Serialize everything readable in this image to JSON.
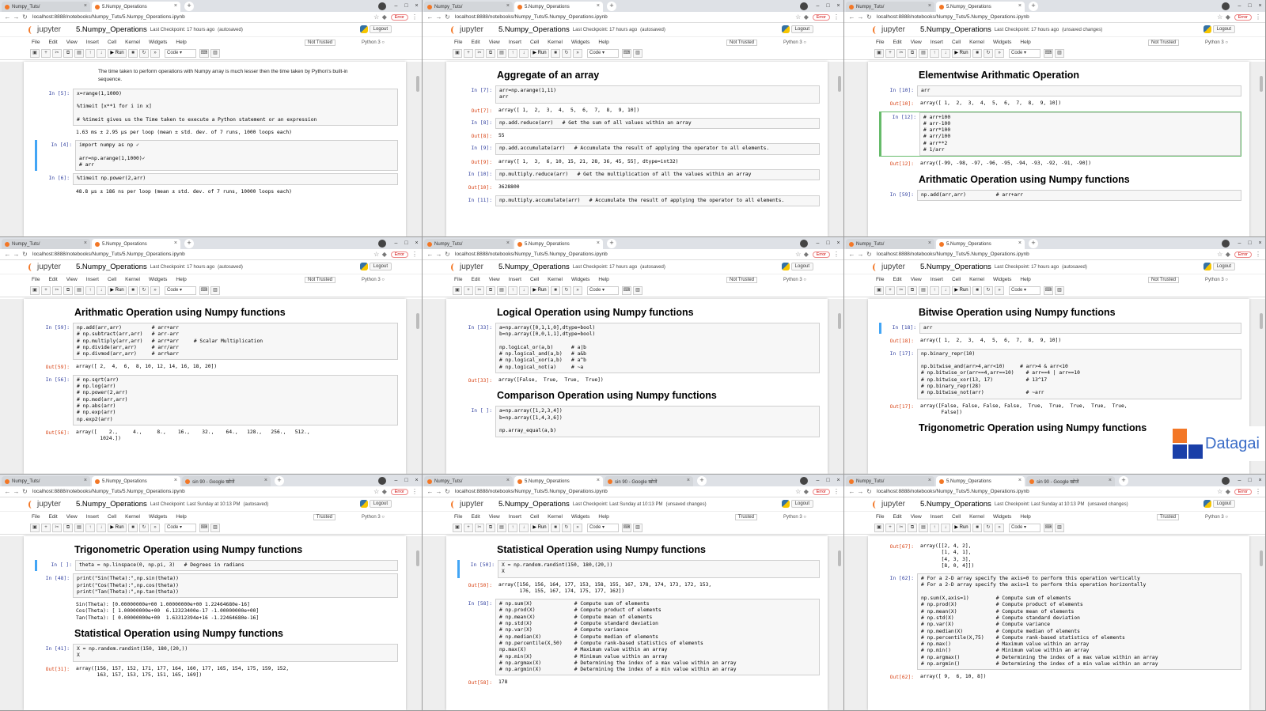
{
  "common": {
    "jupyter": "jupyter",
    "logout": "Logout",
    "not_trusted": "Not Trusted",
    "trusted": "Trusted",
    "kernel": "Python 3",
    "cell_type": "Code",
    "run": "Run",
    "menu": [
      "File",
      "Edit",
      "View",
      "Insert",
      "Cell",
      "Kernel",
      "Widgets",
      "Help"
    ],
    "tab_tuts": "Numpy_Tuts/",
    "tab_ops": "5.Numpy_Operations",
    "tab_google": "sin 90 - Google खोजें",
    "error": "Error"
  },
  "windows": [
    {
      "tabs": [
        "Numpy_Tuts/",
        "5.Numpy_Operations"
      ],
      "url": "localhost:8888/notebooks/Numpy_Tuts/5.Numpy_Operations.ipynb",
      "nb": "5.Numpy_Operations",
      "ckpt": "Last Checkpoint: 17 hours ago",
      "saved": "(autosaved)",
      "cells": [
        {
          "kind": "md",
          "text": "The time taken to perform operations with Numpy array is much lesser then the time taken by Python's built-in sequence."
        },
        {
          "kind": "in",
          "prompt": "In [5]:",
          "code": "x=range(1,1000)\n\n%timeit [x**1 for i in x]\n\n# %timeit gives us the Time taken to execute a Python statement or an expression"
        },
        {
          "kind": "out",
          "prompt": "",
          "text": "1.63 ms ± 2.95 µs per loop (mean ± std. dev. of 7 runs, 1000 loops each)"
        },
        {
          "kind": "in",
          "sel": true,
          "prompt": "In [4]:",
          "code": "import numpy as np ✓\n\narr=np.arange(1,1000)✓\n# arr"
        },
        {
          "kind": "in",
          "prompt": "In [6]:",
          "code": "%timeit np.power(2,arr)"
        },
        {
          "kind": "out",
          "prompt": "",
          "text": "48.8 µs ± 186 ns per loop (mean ± std. dev. of 7 runs, 10000 loops each)"
        }
      ]
    },
    {
      "tabs": [
        "Numpy_Tuts/",
        "5.Numpy_Operations"
      ],
      "url": "localhost:8888/notebooks/Numpy_Tuts/5.Numpy_Operations.ipynb",
      "nb": "5.Numpy_Operations",
      "ckpt": "Last Checkpoint: 17 hours ago",
      "saved": "(autosaved)",
      "cells": [
        {
          "kind": "h",
          "text": "Aggregate of an array"
        },
        {
          "kind": "in",
          "prompt": "In [7]:",
          "code": "arr=np.arange(1,11)\narr"
        },
        {
          "kind": "out",
          "prompt": "Out[7]:",
          "text": "array([ 1,  2,  3,  4,  5,  6,  7,  8,  9, 10])"
        },
        {
          "kind": "in",
          "prompt": "In [8]:",
          "code": "np.add.reduce(arr)   # Get the sum of all values within an array"
        },
        {
          "kind": "out",
          "prompt": "Out[8]:",
          "text": "55"
        },
        {
          "kind": "in",
          "prompt": "In [9]:",
          "code": "np.add.accumulate(arr)   # Accumulate the result of applying the operator to all elements."
        },
        {
          "kind": "out",
          "prompt": "Out[9]:",
          "text": "array([ 1,  3,  6, 10, 15, 21, 28, 36, 45, 55], dtype=int32)"
        },
        {
          "kind": "in",
          "prompt": "In [10]:",
          "code": "np.multiply.reduce(arr)   # Get the multiplication of all the values within an array"
        },
        {
          "kind": "out",
          "prompt": "Out[10]:",
          "text": "3628800"
        },
        {
          "kind": "in",
          "prompt": "In [11]:",
          "code": "np.multiply.accumulate(arr)   # Accumulate the result of applying the operator to all elements."
        }
      ]
    },
    {
      "tabs": [
        "Numpy_Tuts/",
        "5.Numpy_Operations"
      ],
      "url": "localhost:8888/notebooks/Numpy_Tuts/5.Numpy_Operations.ipynb",
      "nb": "5.Numpy_Operations",
      "ckpt": "Last Checkpoint: 17 hours ago",
      "saved": "(unsaved changes)",
      "cells": [
        {
          "kind": "h",
          "text": "Elementwise Arithmatic Operation"
        },
        {
          "kind": "in",
          "prompt": "In [10]:",
          "code": "arr"
        },
        {
          "kind": "out",
          "prompt": "Out[10]:",
          "text": "array([ 1,  2,  3,  4,  5,  6,  7,  8,  9, 10])"
        },
        {
          "kind": "in",
          "edit": true,
          "prompt": "In [12]:",
          "code": "# arr+100\n# arr-100\n# arr*100\n# arr/100\n# arr**2\n# 1/arr"
        },
        {
          "kind": "out",
          "prompt": "Out[12]:",
          "text": "array([-99, -98, -97, -96, -95, -94, -93, -92, -91, -90])"
        },
        {
          "kind": "h",
          "text": "Arithmatic Operation using Numpy functions"
        },
        {
          "kind": "in",
          "prompt": "In [59]:",
          "code": "np.add(arr,arr)          # arr+arr"
        }
      ]
    },
    {
      "tabs": [
        "Numpy_Tuts/",
        "5.Numpy_Operations"
      ],
      "url": "localhost:8888/notebooks/Numpy_Tuts/5.Numpy_Operations.ipynb",
      "nb": "5.Numpy_Operations",
      "ckpt": "Last Checkpoint: 17 hours ago",
      "saved": "(autosaved)",
      "cells": [
        {
          "kind": "h",
          "text": "Arithmatic Operation using Numpy functions"
        },
        {
          "kind": "in",
          "prompt": "In [59]:",
          "code": "np.add(arr,arr)          # arr+arr\n# np.subtract(arr,arr)   # arr-arr\n# np.multiply(arr,arr)   # arr*arr     # Scalar Multiplication\n# np.divide(arr,arr)     # arr/arr\n# np.divmod(arr,arr)     # arr%arr"
        },
        {
          "kind": "out",
          "prompt": "Out[59]:",
          "text": "array([ 2,  4,  6,  8, 10, 12, 14, 16, 18, 20])"
        },
        {
          "kind": "in",
          "prompt": "In [56]:",
          "code": "# np.sqrt(arr)\n# np.log(arr)\n# np.power(2,arr)\n# np.mod(arr,arr)\n# np.abs(arr)\n# np.exp(arr)\nnp.exp2(arr)"
        },
        {
          "kind": "out",
          "prompt": "Out[56]:",
          "text": "array([    2.,     4.,     8.,    16.,    32.,    64.,   128.,   256.,   512.,\n        1024.])"
        }
      ]
    },
    {
      "tabs": [
        "Numpy_Tuts/",
        "5.Numpy_Operations"
      ],
      "url": "localhost:8888/notebooks/Numpy_Tuts/5.Numpy_Operations.ipynb",
      "nb": "5.Numpy_Operations",
      "ckpt": "Last Checkpoint: 17 hours ago",
      "saved": "(autosaved)",
      "cells": [
        {
          "kind": "h",
          "text": "Logical Operation using Numpy functions"
        },
        {
          "kind": "in",
          "prompt": "In [33]:",
          "code": "a=np.array([0,1,1,0],dtype=bool)\nb=np.array([0,0,1,1],dtype=bool)\n\nnp.logical_or(a,b)      # a|b\n# np.logical_and(a,b)   # a&b\n# np.logical_xor(a,b)   # a^b\n# np.logical_not(a)     # ~a"
        },
        {
          "kind": "out",
          "prompt": "Out[33]:",
          "text": "array([False,  True,  True,  True])"
        },
        {
          "kind": "h",
          "text": "Comparison Operation using Numpy functions"
        },
        {
          "kind": "in",
          "prompt": "In [ ]:",
          "code": "a=np.array([1,2,3,4])\nb=np.array([1,4,3,6])\n\nnp.array_equal(a,b)"
        }
      ]
    },
    {
      "tabs": [
        "Numpy_Tuts/",
        "5.Numpy_Operations"
      ],
      "url": "localhost:8888/notebooks/Numpy_Tuts/5.Numpy_Operations.ipynb",
      "nb": "5.Numpy_Operations",
      "ckpt": "Last Checkpoint: 17 hours ago",
      "saved": "(autosaved)",
      "cells": [
        {
          "kind": "h",
          "text": "Bitwise Operation using Numpy functions"
        },
        {
          "kind": "in",
          "sel": true,
          "prompt": "In [18]:",
          "code": "arr"
        },
        {
          "kind": "out",
          "prompt": "Out[18]:",
          "text": "array([ 1,  2,  3,  4,  5,  6,  7,  8,  9, 10])"
        },
        {
          "kind": "in",
          "prompt": "In [17]:",
          "code": "np.binary_repr(10)\n\nnp.bitwise_and(arr>4,arr<10)     # arr>4 & arr<10\n# np.bitwise_or(arr==4,arr==10)    # arr==4 | arr==10\n# np.bitwise_xor(13, 17)           # 13^17\n# np.binary_repr(28)\n# np.bitwise_not(arr)              # ~arr"
        },
        {
          "kind": "out",
          "prompt": "Out[17]:",
          "text": "array([False, False, False, False,  True,  True,  True,  True,  True,\n       False])"
        },
        {
          "kind": "h",
          "text": "Trigonometric Operation using Numpy functions"
        }
      ],
      "logo": "Datagai"
    },
    {
      "tabs": [
        "Numpy_Tuts/",
        "5.Numpy_Operations",
        "sin 90 - Google खोजें"
      ],
      "url": "localhost:8888/notebooks/Numpy_Tuts/5.Numpy_Operations.ipynb",
      "nb": "5.Numpy_Operations",
      "ckpt": "Last Checkpoint: Last Sunday at 10:13 PM",
      "saved": "(autosaved)",
      "cells": [
        {
          "kind": "h",
          "text": "Trigonometric Operation using Numpy functions"
        },
        {
          "kind": "in",
          "sel": true,
          "prompt": "In [ ]:",
          "code": "theta = np.linspace(0, np.pi, 3)   # Degrees in radians"
        },
        {
          "kind": "in",
          "prompt": "In [48]:",
          "code": "print(\"Sin(Theta):\",np.sin(theta))\nprint(\"Cos(Theta):\",np.cos(theta))\nprint(\"Tan(Theta):\",np.tan(theta))"
        },
        {
          "kind": "out",
          "prompt": "",
          "text": "Sin(Theta): [0.00000000e+00 1.00000000e+00 1.22464680e-16]\nCos(Theta): [ 1.00000000e+00  6.12323400e-17 -1.00000000e+00]\nTan(Theta): [ 0.00000000e+00  1.63312394e+16 -1.22464680e-16]"
        },
        {
          "kind": "h",
          "text": "Statistical Operation using Numpy functions"
        },
        {
          "kind": "in",
          "prompt": "In [41]:",
          "code": "X = np.random.randint(150, 180,(20,))\nX"
        },
        {
          "kind": "out",
          "prompt": "Out[31]:",
          "text": "array([156, 157, 152, 171, 177, 164, 160, 177, 165, 154, 175, 159, 152,\n       163, 157, 153, 175, 151, 165, 169])"
        }
      ]
    },
    {
      "tabs": [
        "Numpy_Tuts/",
        "5.Numpy_Operations",
        "sin 90 - Google खोजें"
      ],
      "url": "localhost:8888/notebooks/Numpy_Tuts/5.Numpy_Operations.ipynb",
      "nb": "5.Numpy_Operations",
      "ckpt": "Last Checkpoint: Last Sunday at 10:13 PM",
      "saved": "(unsaved changes)",
      "cells": [
        {
          "kind": "h",
          "text": "Statistical Operation using Numpy functions"
        },
        {
          "kind": "in",
          "sel": true,
          "prompt": "In [50]:",
          "code": "X = np.random.randint(150, 180,(20,))\nX"
        },
        {
          "kind": "out",
          "prompt": "Out[50]:",
          "text": "array([156, 156, 164, 177, 153, 158, 155, 167, 178, 174, 173, 172, 153,\n       176, 155, 167, 174, 175, 177, 162])"
        },
        {
          "kind": "in",
          "prompt": "In [58]:",
          "code": "# np.sum(X)              # Compute sum of elements\n# np.prod(X)             # Compute product of elements\n# np.mean(X)             # Compute mean of elements\n# np.std(X)              # Compute standard deviation\n# np.var(X)              # Compute variance\n# np.median(X)           # Compute median of elements\n# np.percentile(X,50)    # Compute rank-based statistics of elements\nnp.max(X)                # Maximum value within an array\n# np.min(X)              # Minimum value within an array\n# np.argmax(X)           # Determining the index of a max value within an array\n# np.argmin(X)           # Determining the index of a min value within an array"
        },
        {
          "kind": "out",
          "prompt": "Out[58]:",
          "text": "178"
        }
      ]
    },
    {
      "tabs": [
        "Numpy_Tuts/",
        "5.Numpy_Operations",
        "sin 90 - Google खोजें"
      ],
      "url": "localhost:8888/notebooks/Numpy_Tuts/5.Numpy_Operations.ipynb",
      "nb": "5.Numpy_Operations",
      "ckpt": "Last Checkpoint: Last Sunday at 10:13 PM",
      "saved": "(unsaved changes)",
      "cells": [
        {
          "kind": "out",
          "prompt": "Out[67]:",
          "text": "array([[2, 4, 2],\n       [1, 4, 1],\n       [4, 3, 3],\n       [8, 0, 4]])"
        },
        {
          "kind": "in",
          "prompt": "In [62]:",
          "code": "# For a 2-D array specify the axis=0 to perform this operation vertically\n# For a 2-D array specify the axis=1 to perform this operation horizontally\n\nnp.sum(X,axis=1)         # Compute sum of elements\n# np.prod(X)             # Compute product of elements\n# np.mean(X)             # Compute mean of elements\n# np.std(X)              # Compute standard deviation\n# np.var(X)              # Compute variance\n# np.median(X)           # Compute median of elements\n# np.percentile(X,75)    # Compute rank-based statistics of elements\n# np.max()               # Maximum value within an array\n# np.min()               # Minimum value within an array\n# np.argmax()            # Determining the index of a max value within an array\n# np.argmin()            # Determining the index of a min value within an array"
        },
        {
          "kind": "out",
          "prompt": "Out[62]:",
          "text": "array([ 9,  6, 10, 8])"
        }
      ]
    }
  ]
}
